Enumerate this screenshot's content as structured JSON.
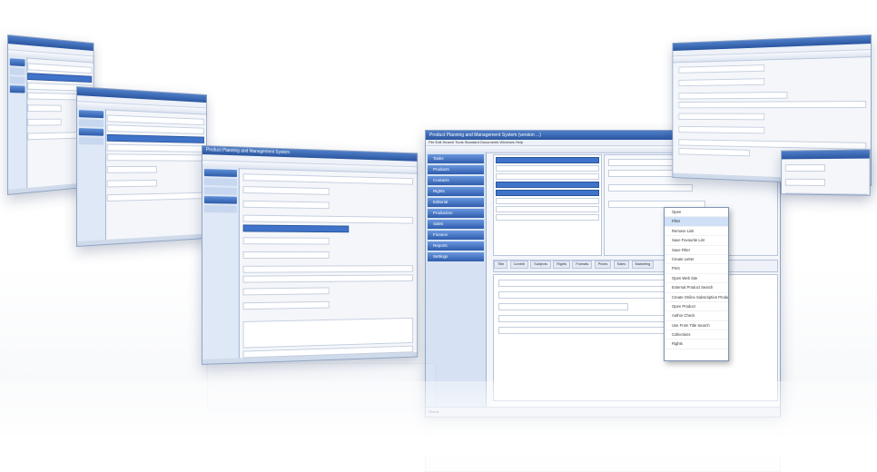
{
  "main_window": {
    "title": "Product Planning and Management System (version ...)",
    "menu": "File  Edit  Search  Tools  Standard Documents  Windows  Help",
    "nav_sections": [
      "Tasks",
      "Products",
      "Contacts",
      "Rights",
      "Editorial",
      "Production",
      "Sales",
      "Finance",
      "Reports",
      "Settings"
    ],
    "content_tabs": [
      "Title",
      "Contrib",
      "Subjects",
      "Rights",
      "Formats",
      "Prices",
      "Sales",
      "Marketing"
    ],
    "context_menu": [
      "Open",
      "Filter",
      "Remove Link",
      "Save Favourite List",
      "Save Filter",
      "Create Letter",
      "Print",
      "Open Web Site",
      "External Product Search",
      "Create Online Subscription Product",
      "Open Product",
      "Author Check",
      "Use From Title Search",
      "Collections",
      "Rights"
    ],
    "status_text": "Ready"
  },
  "center_window": {
    "title": "Product Planning and Management System"
  },
  "background_windows": {
    "count": 4
  }
}
